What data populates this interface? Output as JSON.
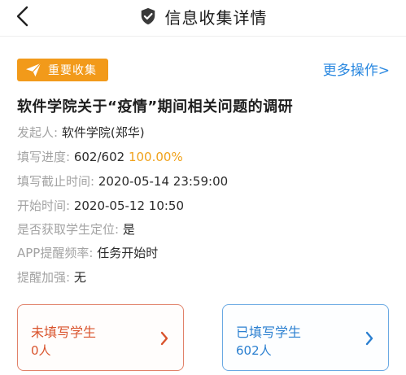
{
  "header": {
    "title": "信息收集详情",
    "back_icon": "chevron-left-icon",
    "title_icon": "shield-check-icon"
  },
  "tag": {
    "label": "重要收集",
    "icon": "paper-plane-icon",
    "color": "#f29a1a"
  },
  "more_link": "更多操作>",
  "survey_title": "软件学院关于“疫情”期间相关问题的调研",
  "info": {
    "initiator": {
      "label": "发起人:",
      "value": "软件学院(郑华)"
    },
    "progress": {
      "label": "填写进度:",
      "value": "602/602",
      "percent": "100.00%"
    },
    "deadline": {
      "label": "填写截止时间:",
      "value": "2020-05-14 23:59:00"
    },
    "start_time": {
      "label": "开始时间:",
      "value": "2020-05-12 10:50"
    },
    "location": {
      "label": "是否获取学生定位:",
      "value": "是"
    },
    "reminder": {
      "label": "APP提醒频率:",
      "value": "任务开始时"
    },
    "reinforce": {
      "label": "提醒加强:",
      "value": "无"
    }
  },
  "cards": {
    "unfilled": {
      "title": "未填写学生",
      "count": "0人",
      "color": "#d9532c"
    },
    "filled": {
      "title": "已填写学生",
      "count": "602人",
      "color": "#2a7fd0"
    }
  }
}
